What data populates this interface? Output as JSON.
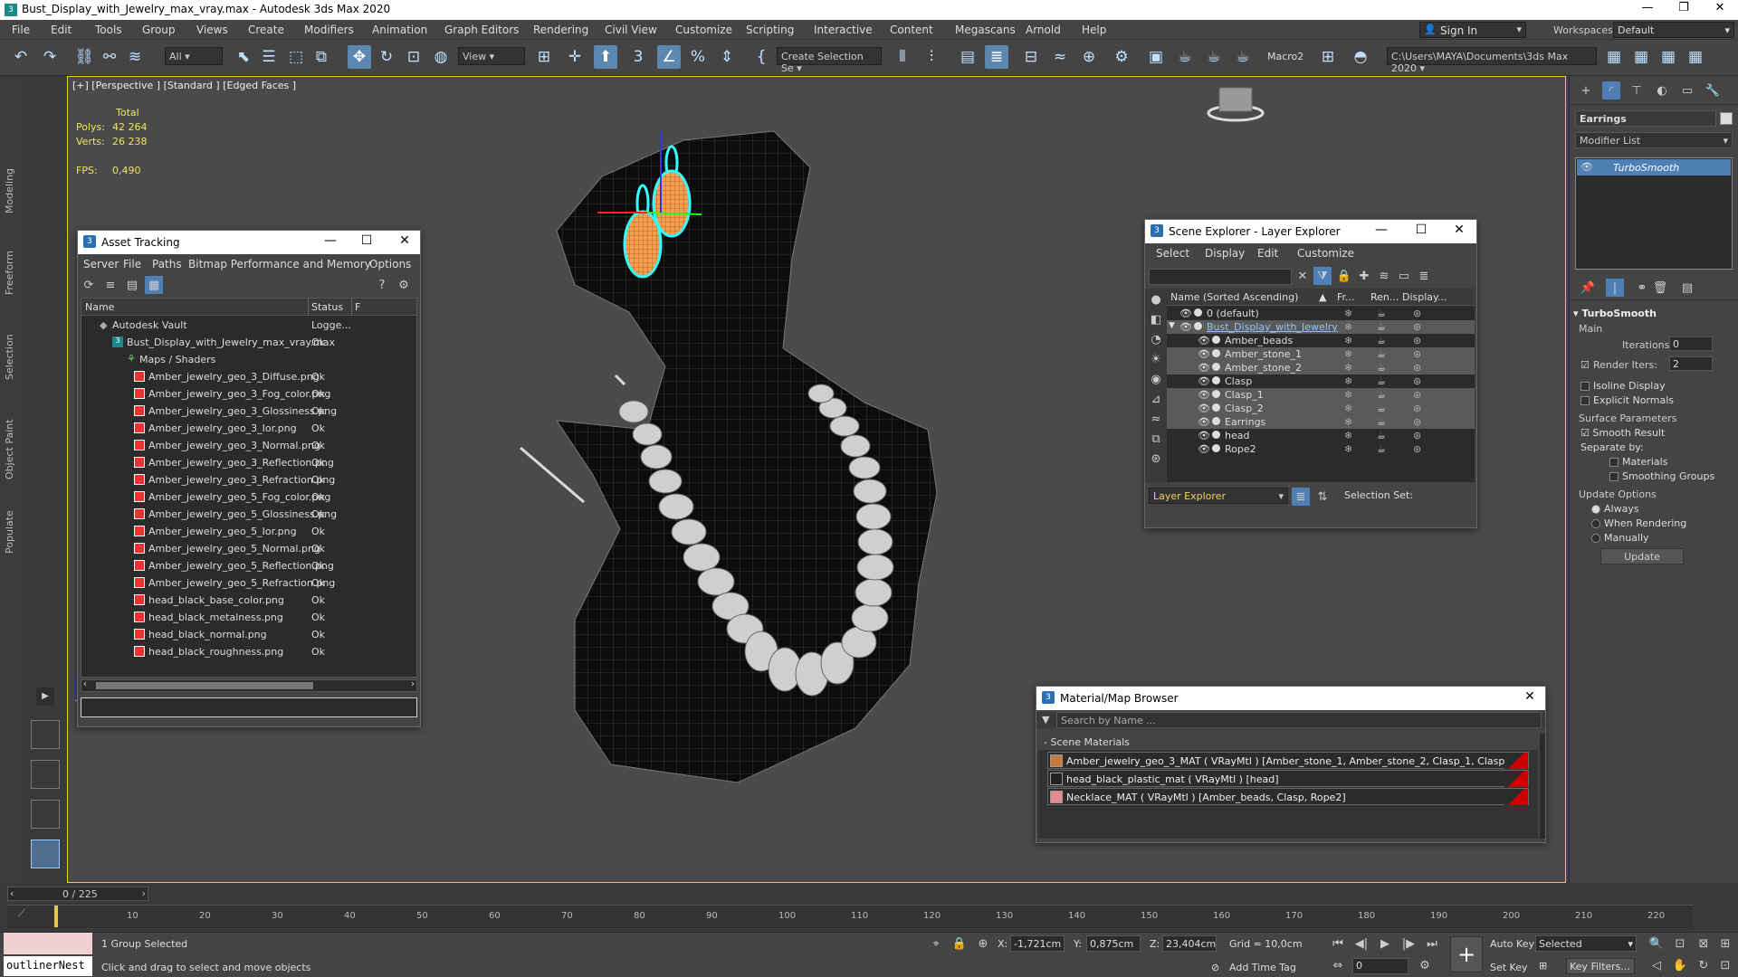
{
  "window": {
    "title": "Bust_Display_with_Jewelry_max_vray.max - Autodesk 3ds Max 2020"
  },
  "menu": [
    "File",
    "Edit",
    "Tools",
    "Group",
    "Views",
    "Create",
    "Modifiers",
    "Animation",
    "Graph Editors",
    "Rendering",
    "Civil View",
    "Customize",
    "Scripting",
    "Interactive",
    "Content",
    "Megascans",
    "Arnold",
    "Help"
  ],
  "account": {
    "sign_in": "Sign In",
    "workspaces_label": "Workspaces:",
    "workspace": "Default"
  },
  "toolbar": {
    "filter": "All",
    "ref_coord": "View",
    "create_selection": "Create Selection Se",
    "macro": "Macro2",
    "path": "C:\\Users\\MAYA\\Documents\\3ds Max 2020"
  },
  "left_tabs": [
    "Modeling",
    "Freeform",
    "Selection",
    "Object Paint",
    "Populate"
  ],
  "viewport": {
    "label": "[+] [Perspective ] [Standard ] [Edged Faces ]",
    "stats": {
      "total_label": "Total",
      "polys_label": "Polys:",
      "polys": "42 264",
      "verts_label": "Verts:",
      "verts": "26 238",
      "fps_label": "FPS:",
      "fps": "0,490"
    }
  },
  "asset_tracking": {
    "title": "Asset Tracking",
    "menu": [
      "Server",
      "File",
      "Paths",
      "Bitmap Performance and Memory",
      "Options"
    ],
    "col_name": "Name",
    "col_status": "Status",
    "col_extra": "F",
    "vault": {
      "name": "Autodesk Vault",
      "status": "Logge..."
    },
    "file": {
      "name": "Bust_Display_with_Jewelry_max_vray.max",
      "status": "Ok"
    },
    "maps_label": "Maps / Shaders",
    "maps": [
      {
        "name": "Amber_jewelry_geo_3_Diffuse.png",
        "status": "Ok"
      },
      {
        "name": "Amber_jewelry_geo_3_Fog_color.png",
        "status": "Ok"
      },
      {
        "name": "Amber_jewelry_geo_3_Glossiness.png",
        "status": "Ok"
      },
      {
        "name": "Amber_jewelry_geo_3_Ior.png",
        "status": "Ok"
      },
      {
        "name": "Amber_jewelry_geo_3_Normal.png",
        "status": "Ok"
      },
      {
        "name": "Amber_jewelry_geo_3_Reflection.png",
        "status": "Ok"
      },
      {
        "name": "Amber_jewelry_geo_3_Refraction.png",
        "status": "Ok"
      },
      {
        "name": "Amber_jewelry_geo_5_Fog_color.png",
        "status": "Ok"
      },
      {
        "name": "Amber_jewelry_geo_5_Glossiness.png",
        "status": "Ok"
      },
      {
        "name": "Amber_jewelry_geo_5_Ior.png",
        "status": "Ok"
      },
      {
        "name": "Amber_jewelry_geo_5_Normal.png",
        "status": "Ok"
      },
      {
        "name": "Amber_jewelry_geo_5_Reflection.png",
        "status": "Ok"
      },
      {
        "name": "Amber_jewelry_geo_5_Refraction.png",
        "status": "Ok"
      },
      {
        "name": "head_black_base_color.png",
        "status": "Ok"
      },
      {
        "name": "head_black_metalness.png",
        "status": "Ok"
      },
      {
        "name": "head_black_normal.png",
        "status": "Ok"
      },
      {
        "name": "head_black_roughness.png",
        "status": "Ok"
      }
    ]
  },
  "scene_explorer": {
    "title": "Scene Explorer - Layer Explorer",
    "menu": [
      "Select",
      "Display",
      "Edit",
      "Customize"
    ],
    "col_name": "Name (Sorted Ascending)",
    "col_fr": "Fr...",
    "col_ren": "Ren...",
    "col_disp": "Display...",
    "rows": [
      {
        "name": "0 (default)",
        "indent": 0,
        "sel": false
      },
      {
        "name": "Bust_Display_with_Jewelry",
        "indent": 0,
        "sel": true,
        "layer": true
      },
      {
        "name": "Amber_beads",
        "indent": 1,
        "sel": false
      },
      {
        "name": "Amber_stone_1",
        "indent": 1,
        "sel": true
      },
      {
        "name": "Amber_stone_2",
        "indent": 1,
        "sel": true
      },
      {
        "name": "Clasp",
        "indent": 1,
        "sel": false
      },
      {
        "name": "Clasp_1",
        "indent": 1,
        "sel": true
      },
      {
        "name": "Clasp_2",
        "indent": 1,
        "sel": true
      },
      {
        "name": "Earrings",
        "indent": 1,
        "sel": true
      },
      {
        "name": "head",
        "indent": 1,
        "sel": false
      },
      {
        "name": "Rope2",
        "indent": 1,
        "sel": false
      }
    ],
    "footer_dropdown": "Layer Explorer",
    "selection_set_label": "Selection Set:"
  },
  "material_browser": {
    "title": "Material/Map Browser",
    "search_placeholder": "Search by Name ...",
    "section": "- Scene Materials",
    "materials": [
      {
        "name": "Amber_jewelry_geo_3_MAT  ( VRayMtl ) [Amber_stone_1, Amber_stone_2, Clasp_1, Clasp_2]"
      },
      {
        "name": "head_black_plastic_mat  ( VRayMtl ) [head]"
      },
      {
        "name": "Necklace_MAT  ( VRayMtl ) [Amber_beads, Clasp, Rope2]"
      }
    ]
  },
  "command_panel": {
    "object_name": "Earrings",
    "modifier_list": "Modifier List",
    "stack": [
      "TurboSmooth"
    ],
    "rollout_title": "TurboSmooth",
    "main_label": "Main",
    "iterations_label": "Iterations:",
    "iterations": "0",
    "render_iters_label": "Render Iters:",
    "render_iters": "2",
    "isoline": "Isoline Display",
    "explicit": "Explicit Normals",
    "surface_params": "Surface Parameters",
    "smooth_result": "Smooth Result",
    "separate_by": "Separate by:",
    "materials": "Materials",
    "smoothing_groups": "Smoothing Groups",
    "update_options": "Update Options",
    "always": "Always",
    "when_rendering": "When Rendering",
    "manually": "Manually",
    "update_button": "Update"
  },
  "timeline": {
    "frame": "0 / 225",
    "ticks": [
      "10",
      "20",
      "30",
      "40",
      "50",
      "60",
      "70",
      "80",
      "90",
      "100",
      "110",
      "120",
      "130",
      "140",
      "150",
      "160",
      "170",
      "180",
      "190",
      "200",
      "210",
      "220"
    ]
  },
  "status": {
    "script_box": "outlinerNest",
    "selection": "1 Group Selected",
    "prompt": "Click and drag to select and move objects",
    "x_label": "X:",
    "x": "-1,721cm",
    "y_label": "Y:",
    "y": "0,875cm",
    "z_label": "Z:",
    "z": "23,404cm",
    "grid": "Grid = 10,0cm",
    "add_time_tag": "Add Time Tag",
    "auto_key": "Auto Key",
    "selected": "Selected",
    "set_key": "Set Key",
    "key_filters": "Key Filters...",
    "frame_input": "0"
  }
}
